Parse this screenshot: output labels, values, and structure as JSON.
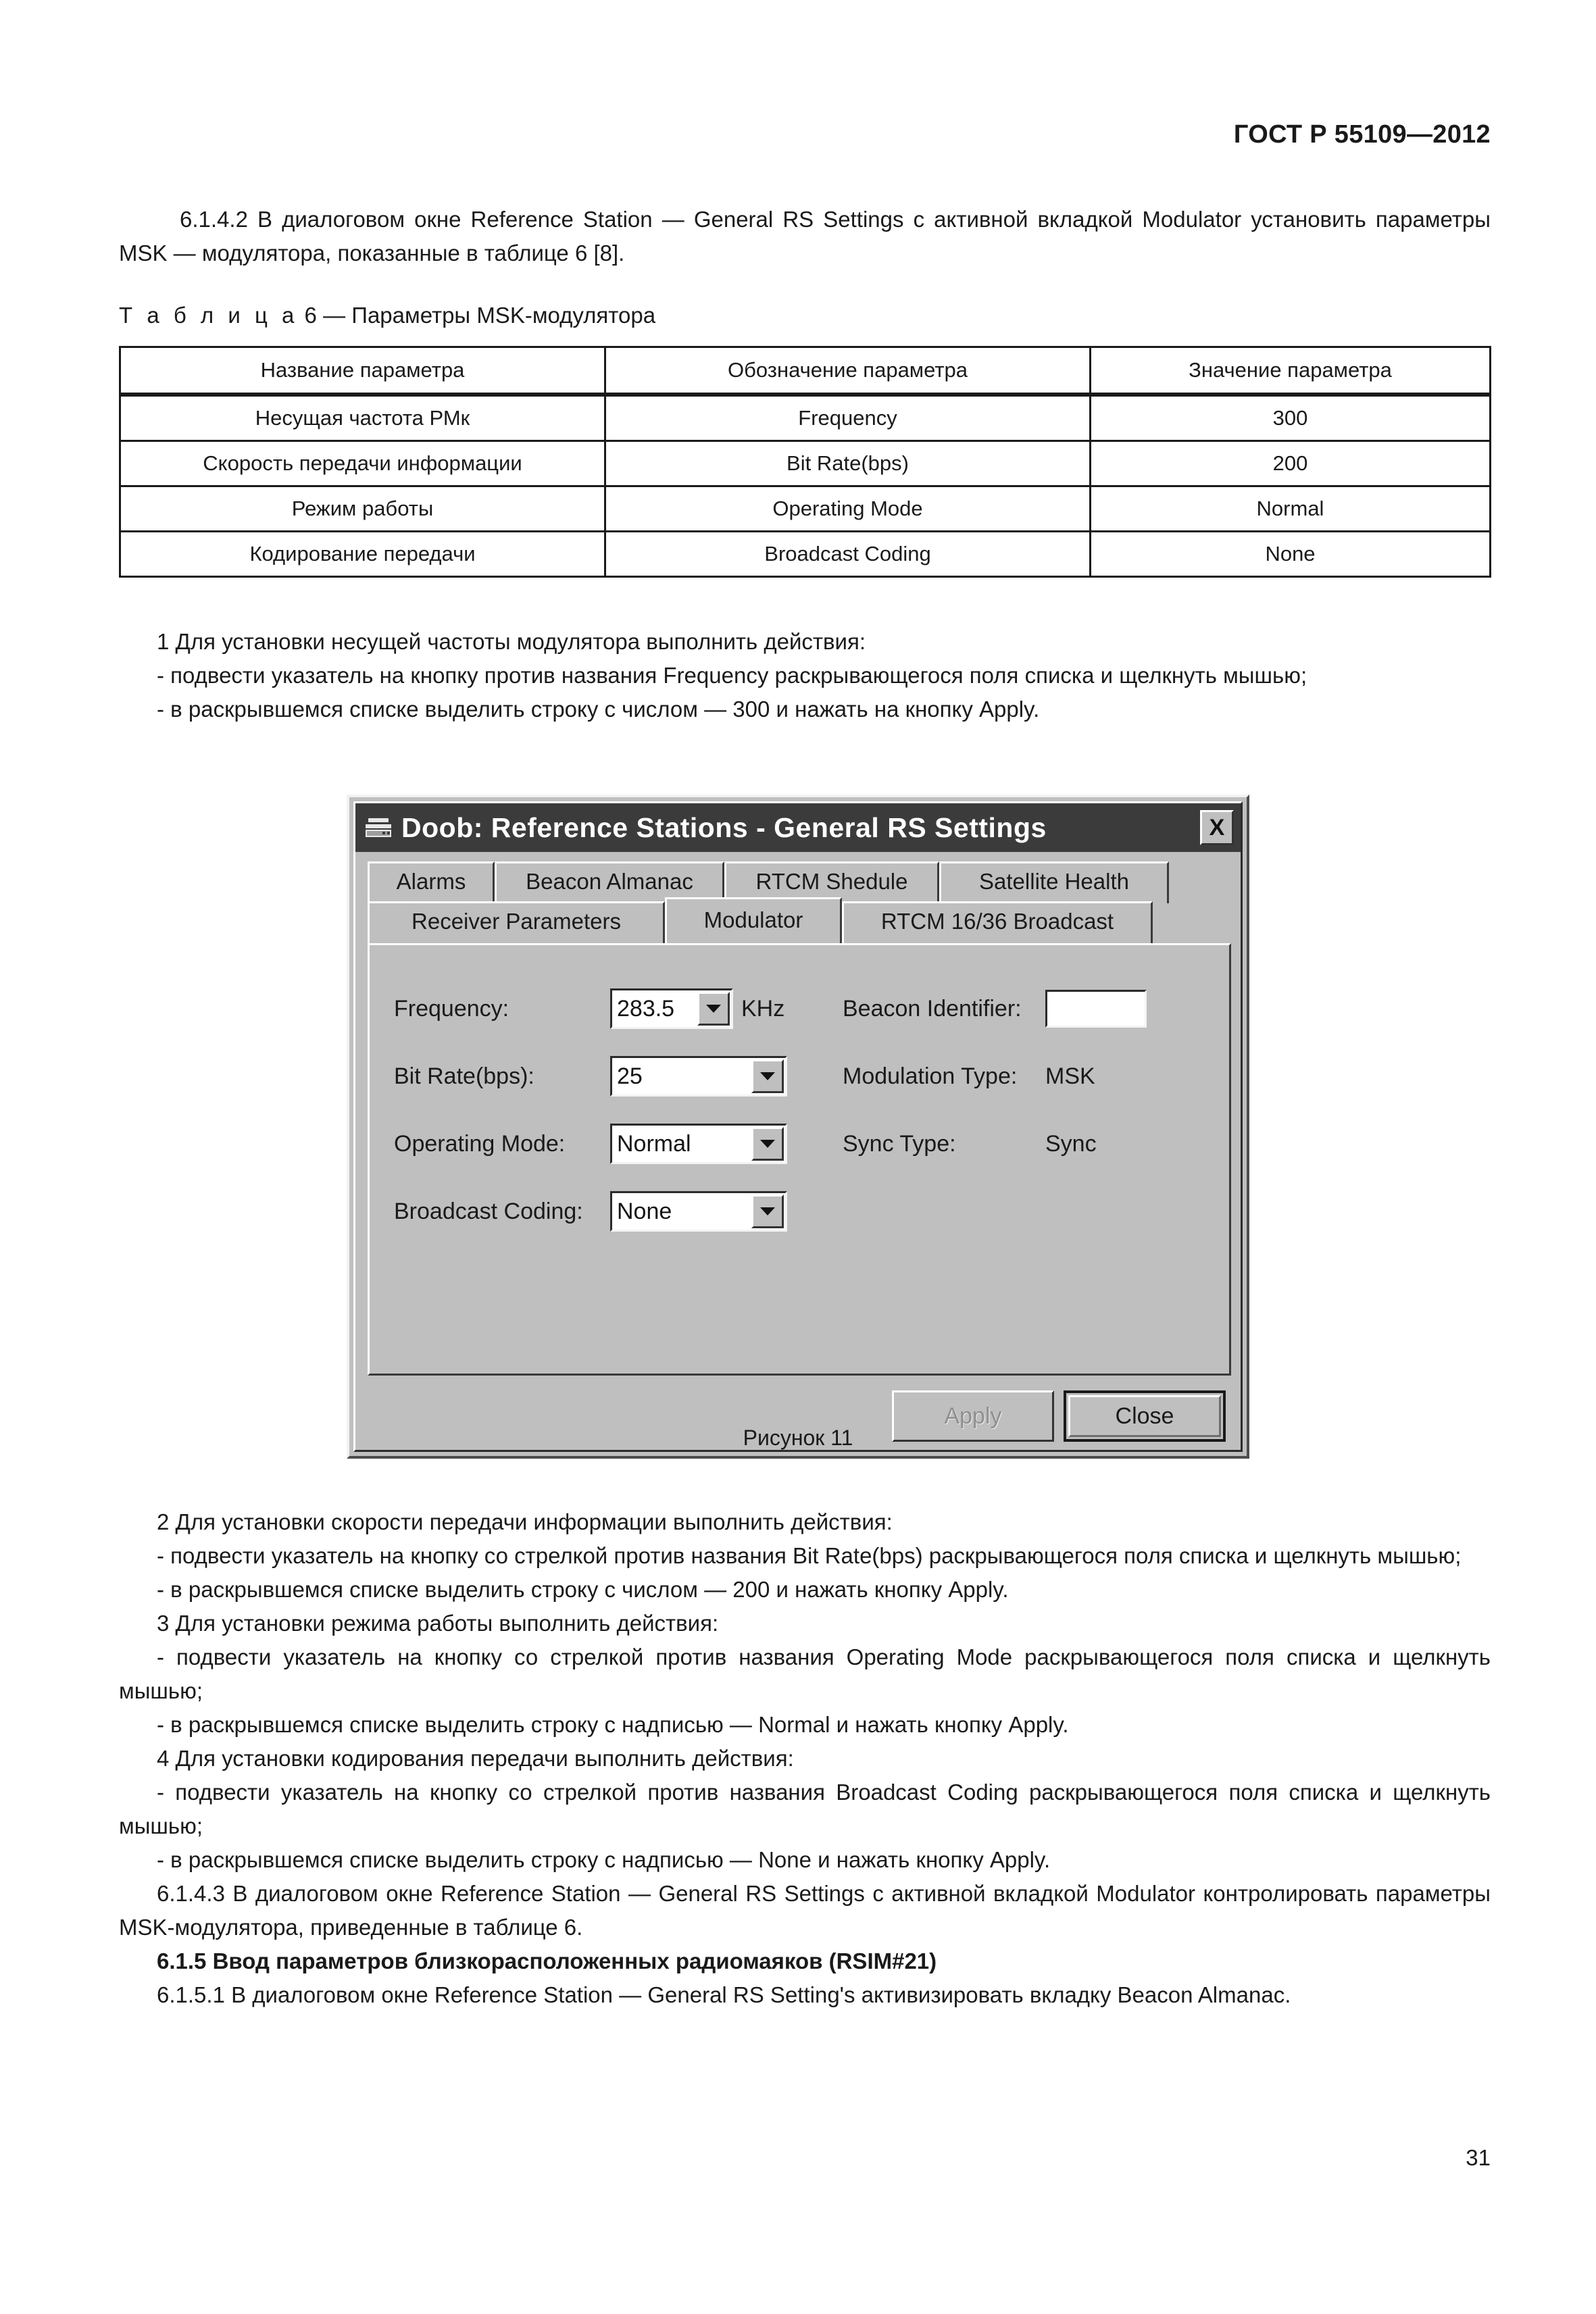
{
  "document": {
    "standard_header": "ГОСТ Р 55109—2012",
    "page_number": "31"
  },
  "body": {
    "para_6142": "6.1.4.2 В диалоговом окне Reference Station — General RS Settings с активной вкладкой Modulator установить параметры MSK — модулятора, показанные в таблице 6 [8].",
    "table_caption_prefix": "Т а б л и ц а",
    "table_caption_rest": "6 — Параметры MSK-модулятора",
    "list1_head": "1 Для установки несущей частоты модулятора выполнить действия:",
    "list1_item1": "- подвести указатель на кнопку против названия Frequency  раскрывающегося поля списка и щелкнуть мышью;",
    "list1_item2": "- в раскрывшемся списке выделить строку с числом — 300 и нажать на кнопку Apply.",
    "figure_caption": "Рисунок 11",
    "list2_head": "2 Для установки скорости передачи информации выполнить действия:",
    "list2_item1": "- подвести указатель на кнопку со стрелкой против названия Bit Rate(bps) раскрывающегося поля списка и щелкнуть мышью;",
    "list2_item2": "- в раскрывшемся списке выделить строку с числом — 200 и нажать кнопку Apply.",
    "list3_head": "3 Для установки режима работы выполнить действия:",
    "list3_item1": "- подвести указатель на кнопку со стрелкой против названия Operating Mode раскрывающегося поля списка и щелкнуть мышью;",
    "list3_item2": "- в раскрывшемся списке выделить строку с надписью — Normal и нажать кнопку Apply.",
    "list4_head": "4 Для установки кодирования передачи выполнить действия:",
    "list4_item1": "- подвести указатель на кнопку со стрелкой против названия Broadcast Coding раскрывающегося поля списка и щелкнуть мышью;",
    "list4_item2": "- в раскрывшемся списке выделить строку с надписью — None и нажать кнопку Apply.",
    "para_6143": "6.1.4.3 В диалоговом окне Reference Station — General RS Settings с активной вкладкой Modulator контролировать параметры MSK-модулятора, приведенные в таблице 6.",
    "heading_615": "6.1.5 Ввод параметров близкорасположенных радиомаяков (RSIM#21)",
    "para_6151": "6.1.5.1 В диалоговом окне Reference Station — General RS Setting's активизировать вкладку Beacon Almanac."
  },
  "table": {
    "headers": [
      "Название параметра",
      "Обозначение параметра",
      "Значение параметра"
    ],
    "rows": [
      [
        "Несущая частота РМк",
        "Frequency",
        "300"
      ],
      [
        "Скорость передачи информации",
        "Bit Rate(bps)",
        "200"
      ],
      [
        "Режим работы",
        "Operating Mode",
        "Normal"
      ],
      [
        "Кодирование передачи",
        "Broadcast Coding",
        "None"
      ]
    ]
  },
  "dialog": {
    "title": "Doob: Reference Stations - General RS Settings",
    "close_glyph": "X",
    "tabs_row1": [
      "Alarms",
      "Beacon Almanac",
      "RTCM Shedule",
      "Satellite Health"
    ],
    "tabs_row2": [
      "Receiver Parameters",
      "Modulator",
      "RTCM 16/36 Broadcast"
    ],
    "active_tab": "Modulator",
    "fields": {
      "frequency_label": "Frequency:",
      "frequency_value": "283.5",
      "frequency_unit": "KHz",
      "bitrate_label": "Bit Rate(bps):",
      "bitrate_value": "25",
      "operating_mode_label": "Operating Mode:",
      "operating_mode_value": "Normal",
      "broadcast_coding_label": "Broadcast Coding:",
      "broadcast_coding_value": "None",
      "beacon_identifier_label": "Beacon Identifier:",
      "beacon_identifier_value": "",
      "modulation_type_label": "Modulation Type:",
      "modulation_type_value": "MSK",
      "sync_type_label": "Sync Type:",
      "sync_type_value": "Sync"
    },
    "buttons": {
      "apply": "Apply",
      "close": "Close"
    },
    "colors": {
      "face": "#bfbfbf",
      "titlebar": "#3b3b3b",
      "field_bg": "#ffffff"
    }
  }
}
